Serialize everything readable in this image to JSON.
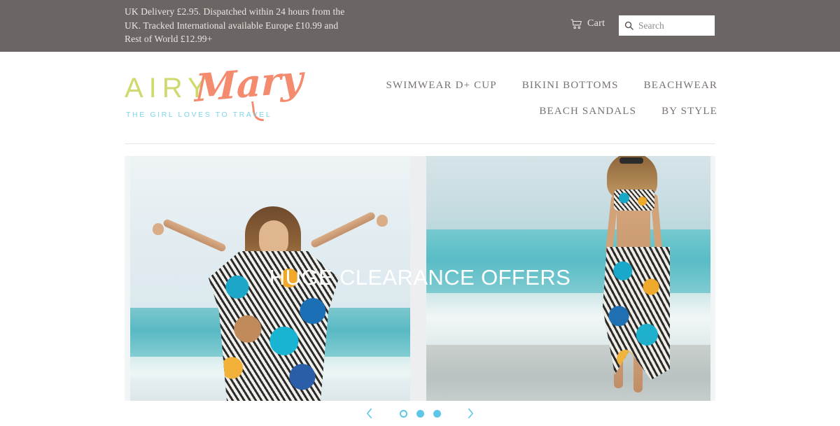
{
  "topbar": {
    "delivery_note": "UK Delivery £2.95. Dispatched within 24 hours from the UK. Tracked International available Europe £10.99 and Rest of World £12.99+",
    "cart_label": "Cart",
    "cart_icon": "shopping-cart-icon",
    "search": {
      "placeholder": "Search",
      "value": "",
      "icon": "search-icon"
    },
    "background_color": "#6b6663"
  },
  "header": {
    "logo": {
      "word_one": "AIRY",
      "word_two": "Mary",
      "tagline": "THE GIRL LOVES TO TRAVEL",
      "color_word_one": "#cfd96e",
      "color_word_two": "#f48a6e",
      "color_tagline": "#7fd4e8"
    },
    "nav": {
      "row_one": [
        {
          "label": "SWIMWEAR D+ CUP",
          "name": "nav-item-swimwear-d-cup"
        },
        {
          "label": "BIKINI BOTTOMS",
          "name": "nav-item-bikini-bottoms"
        },
        {
          "label": "BEACHWEAR",
          "name": "nav-item-beachwear"
        }
      ],
      "row_two": [
        {
          "label": "BEACH SANDALS",
          "name": "nav-item-beach-sandals"
        },
        {
          "label": "BY STYLE",
          "name": "nav-item-by-style"
        }
      ],
      "text_color": "#77726f"
    }
  },
  "hero": {
    "caption": "HUGE CLEARANCE OFFERS",
    "caption_color": "#ffffff",
    "slides": [
      {
        "alt": "Woman in printed blue and orange kaftan with arms raised on a beach"
      },
      {
        "alt": "Woman in printed bikini and matching sarong walking along the shoreline"
      }
    ]
  },
  "carousel": {
    "prev_icon": "chevron-left-icon",
    "next_icon": "chevron-right-icon",
    "accent_color": "#5cc7e6",
    "dots": [
      {
        "active": true
      },
      {
        "active": false
      },
      {
        "active": false
      }
    ]
  }
}
